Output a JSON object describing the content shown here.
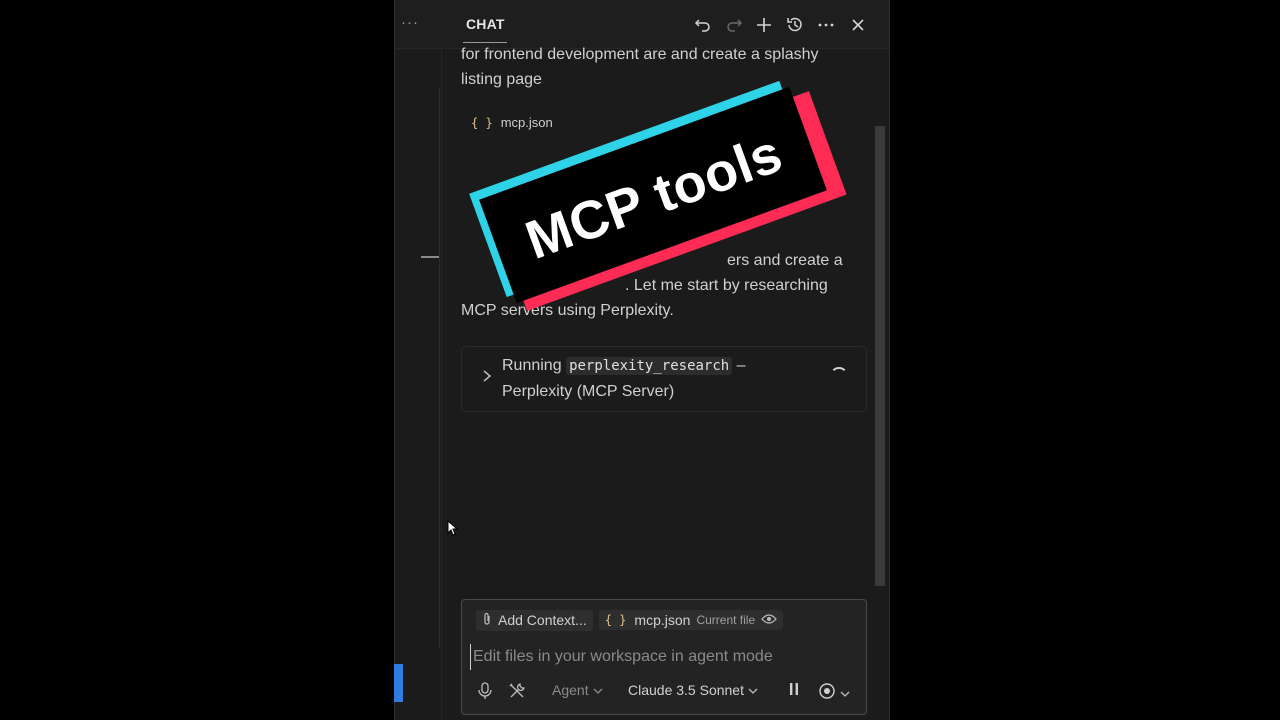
{
  "titlebar": {
    "tab_label": "CHAT",
    "icons": [
      "undo-icon",
      "redo-icon",
      "plus-icon",
      "history-icon",
      "more-icon",
      "close-icon"
    ]
  },
  "messages": {
    "user_line1": "for frontend development are and create a splashy",
    "user_line2": "listing page",
    "file_ref": "mcp.json",
    "agent_line1": "ers and create a",
    "agent_line2": ". Let me start by researching",
    "agent_line3": "MCP servers using Perplexity."
  },
  "tool_call": {
    "prefix": "Running",
    "tool_name": "perplexity_research",
    "dash": "–",
    "server": "Perplexity (MCP Server)"
  },
  "input": {
    "add_context": "Add Context...",
    "file_chip": "mcp.json",
    "file_chip_note": "Current file",
    "placeholder": "Edit files in your workspace in agent mode",
    "mode": "Agent",
    "model": "Claude 3.5 Sonnet"
  },
  "overlay": {
    "text": "MCP tools",
    "colors": {
      "cyan": "#2fd3e8",
      "red": "#fe2c55",
      "black": "#000000"
    }
  }
}
